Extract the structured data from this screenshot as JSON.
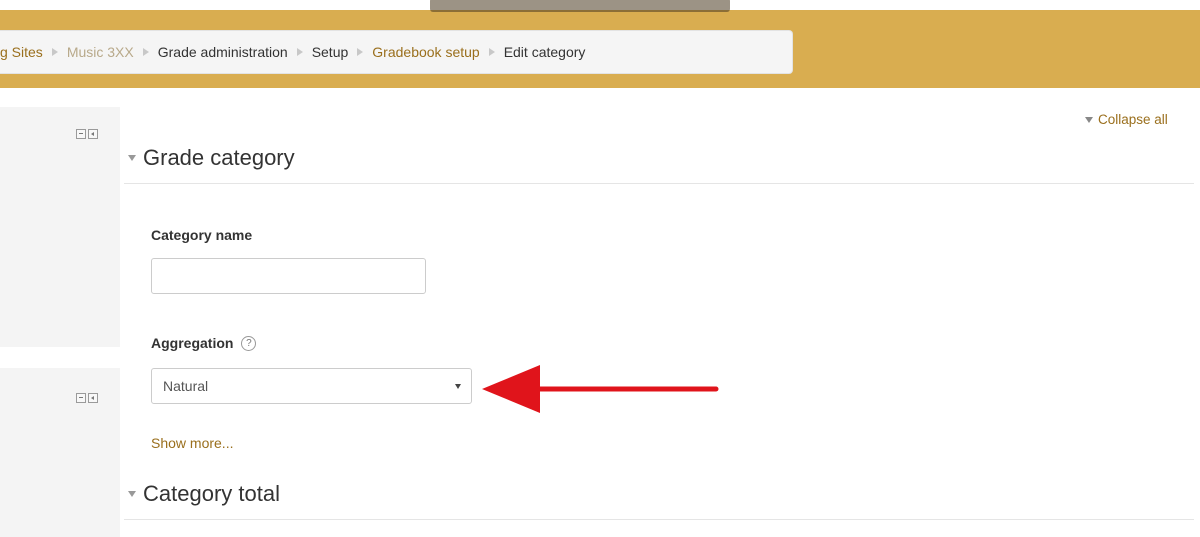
{
  "breadcrumb": {
    "items": [
      {
        "label": "g Sites",
        "style": "link"
      },
      {
        "label": "Music 3XX",
        "style": "muted"
      },
      {
        "label": "Grade administration",
        "style": "plain"
      },
      {
        "label": "Setup",
        "style": "plain"
      },
      {
        "label": "Gradebook setup",
        "style": "link"
      },
      {
        "label": "Edit category",
        "style": "current"
      }
    ]
  },
  "toolbar": {
    "collapse_all_label": "Collapse all"
  },
  "sections": {
    "grade_category": {
      "title": "Grade category",
      "category_name_label": "Category name",
      "category_name_value": "",
      "aggregation_label": "Aggregation",
      "help_glyph": "?",
      "aggregation_selected": "Natural",
      "show_more_label": "Show more..."
    },
    "category_total": {
      "title": "Category total"
    }
  },
  "colors": {
    "header_band": "#d9ad50",
    "link": "#9a6f1d",
    "annotation_arrow": "#e0141b"
  },
  "icons": {
    "block_controls": [
      "minus-icon",
      "dock-icon"
    ],
    "annotation": "red-arrow-icon"
  }
}
